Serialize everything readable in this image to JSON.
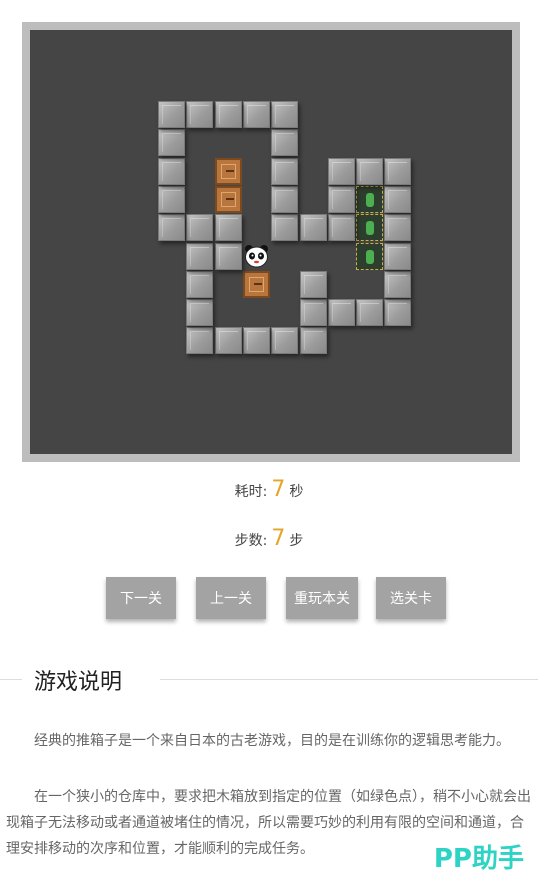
{
  "stats": {
    "time_label": "耗时:",
    "time_value": "7",
    "time_unit": "秒",
    "steps_label": "步数:",
    "steps_value": "7",
    "steps_unit": "步"
  },
  "buttons": {
    "next": "下一关",
    "prev": "上一关",
    "replay": "重玩本关",
    "select": "选关卡"
  },
  "instructions": {
    "title": "游戏说明",
    "para1": "　　经典的推箱子是一个来自日本的古老游戏，目的是在训练你的逻辑思考能力。",
    "para2": "　　在一个狭小的仓库中，要求把木箱放到指定的位置（如绿色点），稍不小心就会出现箱子无法移动或者通道被堵住的情况，所以需要巧妙的利用有限的空间和通道，合理安排移动的次序和位置，才能顺利的完成任务。"
  },
  "watermark": "PP助手"
}
